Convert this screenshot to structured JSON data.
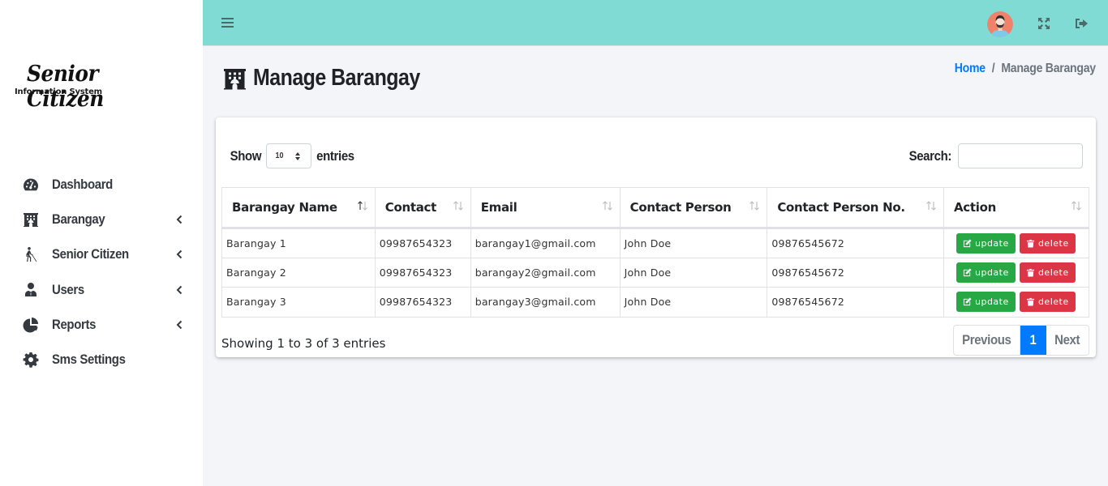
{
  "app": {
    "logo_title": "Senior Citizen",
    "logo_subtitle": "Information System"
  },
  "sidebar": {
    "items": [
      {
        "label": "Dashboard",
        "icon": "tachometer-icon",
        "has_submenu": false
      },
      {
        "label": "Barangay",
        "icon": "building-icon",
        "has_submenu": true
      },
      {
        "label": "Senior Citizen",
        "icon": "blind-person-icon",
        "has_submenu": true
      },
      {
        "label": "Users",
        "icon": "user-tie-icon",
        "has_submenu": true
      },
      {
        "label": "Reports",
        "icon": "pie-chart-icon",
        "has_submenu": true
      },
      {
        "label": "Sms Settings",
        "icon": "gear-icon",
        "has_submenu": false
      }
    ]
  },
  "topbar": {
    "menu_icon": "hamburger-icon",
    "avatar_icon": "user-avatar-icon",
    "fullscreen_icon": "expand-icon",
    "logout_icon": "sign-out-icon"
  },
  "page": {
    "title": "Manage Barangay",
    "title_icon": "building-icon",
    "breadcrumb": {
      "home": "Home",
      "separator": "/",
      "current": "Manage Barangay"
    }
  },
  "table_controls": {
    "show_label": "Show",
    "entries_label": "entries",
    "page_length": "10",
    "search_label": "Search:",
    "search_value": ""
  },
  "table": {
    "columns": [
      "Barangay Name",
      "Contact",
      "Email",
      "Contact Person",
      "Contact Person No.",
      "Action"
    ],
    "rows": [
      {
        "name": "Barangay 1",
        "contact": "09987654323",
        "email": "barangay1@gmail.com",
        "contact_person": "John Doe",
        "contact_person_no": "09876545672"
      },
      {
        "name": "Barangay 2",
        "contact": "09987654323",
        "email": "barangay2@gmail.com",
        "contact_person": "John Doe",
        "contact_person_no": "09876545672"
      },
      {
        "name": "Barangay 3",
        "contact": "09987654323",
        "email": "barangay3@gmail.com",
        "contact_person": "John Doe",
        "contact_person_no": "09876545672"
      }
    ],
    "update_label": "update",
    "delete_label": "delete"
  },
  "footer": {
    "info": "Showing 1 to 3 of 3 entries",
    "pagination": {
      "previous": "Previous",
      "current_page": "1",
      "next": "Next"
    }
  },
  "colors": {
    "topbar": "#80dbd5",
    "primary": "#007bff",
    "success": "#28a745",
    "danger": "#dc3545"
  }
}
